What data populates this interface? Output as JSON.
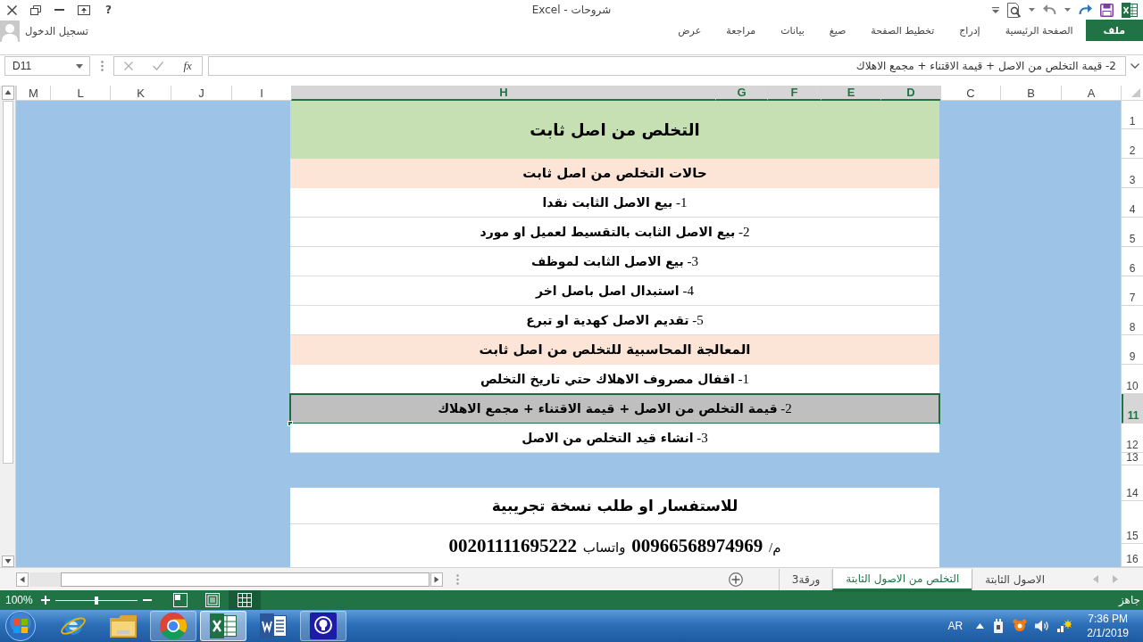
{
  "window": {
    "title": "شروحات - Excel",
    "help_button": "?"
  },
  "ribbon": {
    "sign_in": "تسجيل الدخول",
    "tabs": [
      {
        "label": "ملف",
        "selected": true
      },
      {
        "label": "الصفحة الرئيسية",
        "selected": false
      },
      {
        "label": "إدراج",
        "selected": false
      },
      {
        "label": "تخطيط الصفحة",
        "selected": false
      },
      {
        "label": "صيغ",
        "selected": false
      },
      {
        "label": "بيانات",
        "selected": false
      },
      {
        "label": "مراجعة",
        "selected": false
      },
      {
        "label": "عرض",
        "selected": false
      }
    ]
  },
  "formula_bar": {
    "name_box": "D11",
    "insert_function": "fx",
    "formula": "2- قيمة التخلص من الاصل + قيمة الاقتناء + مجمع الاهلاك"
  },
  "columns": [
    {
      "label": "A",
      "selected": false
    },
    {
      "label": "B",
      "selected": false
    },
    {
      "label": "C",
      "selected": false
    },
    {
      "label": "D",
      "selected": true
    },
    {
      "label": "E",
      "selected": true
    },
    {
      "label": "F",
      "selected": true
    },
    {
      "label": "G",
      "selected": true
    },
    {
      "label": "H",
      "selected": true
    },
    {
      "label": "I",
      "selected": false
    },
    {
      "label": "J",
      "selected": false
    },
    {
      "label": "K",
      "selected": false
    },
    {
      "label": "L",
      "selected": false
    },
    {
      "label": "M",
      "selected": false
    }
  ],
  "rows": [
    {
      "label": "1",
      "selected": false
    },
    {
      "label": "2",
      "selected": false
    },
    {
      "label": "3",
      "selected": false
    },
    {
      "label": "4",
      "selected": false
    },
    {
      "label": "5",
      "selected": false
    },
    {
      "label": "6",
      "selected": false
    },
    {
      "label": "7",
      "selected": false
    },
    {
      "label": "8",
      "selected": false
    },
    {
      "label": "9",
      "selected": false
    },
    {
      "label": "10",
      "selected": false
    },
    {
      "label": "11",
      "selected": true
    },
    {
      "label": "12",
      "selected": false
    },
    {
      "label": "13",
      "selected": false
    },
    {
      "label": "14",
      "selected": false
    },
    {
      "label": "15",
      "selected": false
    },
    {
      "label": "16",
      "selected": false
    }
  ],
  "sheet": {
    "blocks": [
      {
        "kind": "title",
        "text": "التخلص من اصل ثابت",
        "selected": false
      },
      {
        "kind": "section",
        "text": "حالات التخلص من اصل ثابت",
        "selected": false
      },
      {
        "kind": "item",
        "text": "1- **بيع الاصل الثابت نقدا**",
        "selected": false
      },
      {
        "kind": "item",
        "text": "2- **بيع الاصل الثابت بالتقسيط لعميل او مورد**",
        "selected": false
      },
      {
        "kind": "item",
        "text": "3- **بيع الاصل الثابت لموظف**",
        "selected": false
      },
      {
        "kind": "item",
        "text": "4- **استبدال اصل باصل اخر**",
        "selected": false
      },
      {
        "kind": "item",
        "text": "5- **تقديم الاصل كهدية او تبرع**",
        "selected": false
      },
      {
        "kind": "section",
        "text": "المعالجة المحاسبية للتخلص من اصل ثابت",
        "selected": false
      },
      {
        "kind": "item",
        "text": "1- **اقفال مصروف الاهلاك حتي تاريخ التخلص**",
        "selected": false
      },
      {
        "kind": "item",
        "text": "2- **قيمة التخلص من الاصل + قيمة الاقتناء + مجمع الاهلاك**",
        "selected": true
      },
      {
        "kind": "item",
        "text": "3- **انشاء قيد التخلص من الاصل**",
        "selected": false
      }
    ],
    "contact": {
      "heading": "للاستفسار او طلب نسخة تجريبية",
      "line": "م/ **00966568974969** واتساب **00201111695222**"
    }
  },
  "sheet_tabs": [
    {
      "label": "الاصول الثابتة",
      "selected": false
    },
    {
      "label": "التخلص من الاصول الثابتة",
      "selected": true
    },
    {
      "label": "ورقة3",
      "selected": false
    }
  ],
  "status_bar": {
    "zoom": "100%",
    "zoom_slider": {
      "level": 0.5
    },
    "views": [
      {
        "kind": "page_break",
        "selected": false
      },
      {
        "kind": "page_layout",
        "selected": false
      },
      {
        "kind": "normal",
        "selected": true
      }
    ],
    "status": "جاهز"
  },
  "taskbar": {
    "apps": [
      {
        "kind": "ie",
        "running": false,
        "selected": false
      },
      {
        "kind": "explorer",
        "running": false,
        "selected": false
      },
      {
        "kind": "chrome",
        "running": true,
        "selected": false
      },
      {
        "kind": "excel",
        "running": true,
        "selected": true
      },
      {
        "kind": "word",
        "running": false,
        "selected": false
      },
      {
        "kind": "presenter",
        "running": true,
        "selected": false
      }
    ],
    "language": "AR",
    "time": "7:36 PM",
    "date": "2/1/2019"
  }
}
